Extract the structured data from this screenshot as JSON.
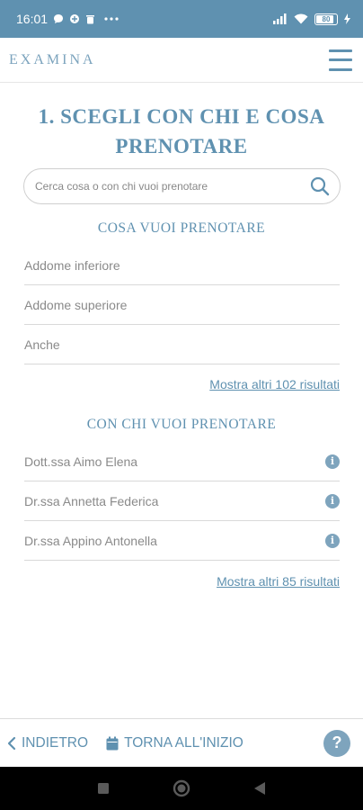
{
  "status_bar": {
    "time": "16:01",
    "battery": "80",
    "icons": [
      "chat-bubble-icon",
      "data-saver-icon",
      "trash-icon",
      "more-dots-icon",
      "signal-icon",
      "wifi-icon",
      "battery-icon",
      "charging-icon"
    ]
  },
  "header": {
    "logo": "EXAMINA",
    "menu_icon": "hamburger-menu-icon"
  },
  "main": {
    "title": "1. SCEGLI CON CHI E COSA PRENOTARE",
    "search": {
      "placeholder": "Cerca cosa o con chi vuoi prenotare",
      "value": ""
    },
    "what_section": {
      "title": "COSA VUOI PRENOTARE",
      "items": [
        {
          "label": "Addome inferiore"
        },
        {
          "label": "Addome superiore"
        },
        {
          "label": "Anche"
        }
      ],
      "more_link": "Mostra altri 102 risultati"
    },
    "who_section": {
      "title": "CON CHI VUOI PRENOTARE",
      "items": [
        {
          "label": "Dott.ssa Aimo Elena"
        },
        {
          "label": "Dr.ssa Annetta Federica"
        },
        {
          "label": "Dr.ssa Appino Antonella"
        }
      ],
      "more_link": "Mostra altri 85 risultati"
    }
  },
  "bottom_bar": {
    "back_label": "INDIETRO",
    "restart_label": "TORNA ALL'INIZIO",
    "help_label": "?"
  },
  "colors": {
    "accent": "#5f91b0",
    "icon_fill": "#7ea4bd",
    "divider": "#d9d9d9",
    "android_nav": "#000000"
  }
}
